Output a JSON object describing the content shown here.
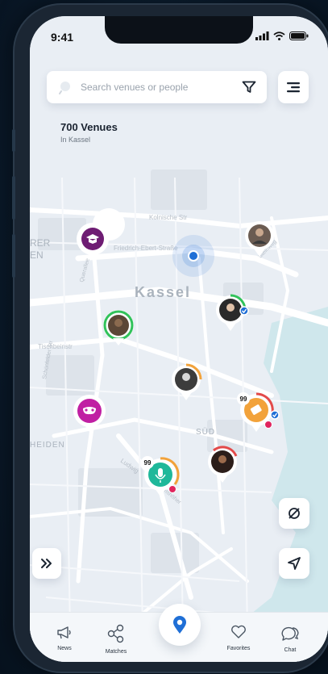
{
  "status_bar": {
    "time": "9:41"
  },
  "search": {
    "placeholder": "Search venues or people"
  },
  "venues": {
    "count": "700 Venues",
    "location": "In Kassel"
  },
  "map": {
    "labels": [
      "Kolnische Str",
      "Kassel",
      "Tischbeinstr",
      "SÜD",
      "HEIDEN",
      "RER",
      "EN",
      "Schönfelder Str",
      "Ludwig",
      "Querallee",
      "Friedrich-Ebert-Straße",
      "Steinweg",
      "Wilhelmshöher"
    ],
    "badges": [
      "99",
      "99"
    ]
  },
  "tabs": [
    {
      "label": "News",
      "icon": "megaphone-icon"
    },
    {
      "label": "Matches",
      "icon": "share-nodes-icon"
    },
    {
      "label": "Favorites",
      "icon": "heart-icon"
    },
    {
      "label": "Chat",
      "icon": "chat-icon"
    }
  ],
  "colors": {
    "accent": "#1f6fd6",
    "purple": "#6e1c73",
    "magenta": "#c01fa3",
    "teal": "#1fb89a",
    "orange": "#f2a23a",
    "green": "#31c25a",
    "red": "#e34a4a"
  }
}
